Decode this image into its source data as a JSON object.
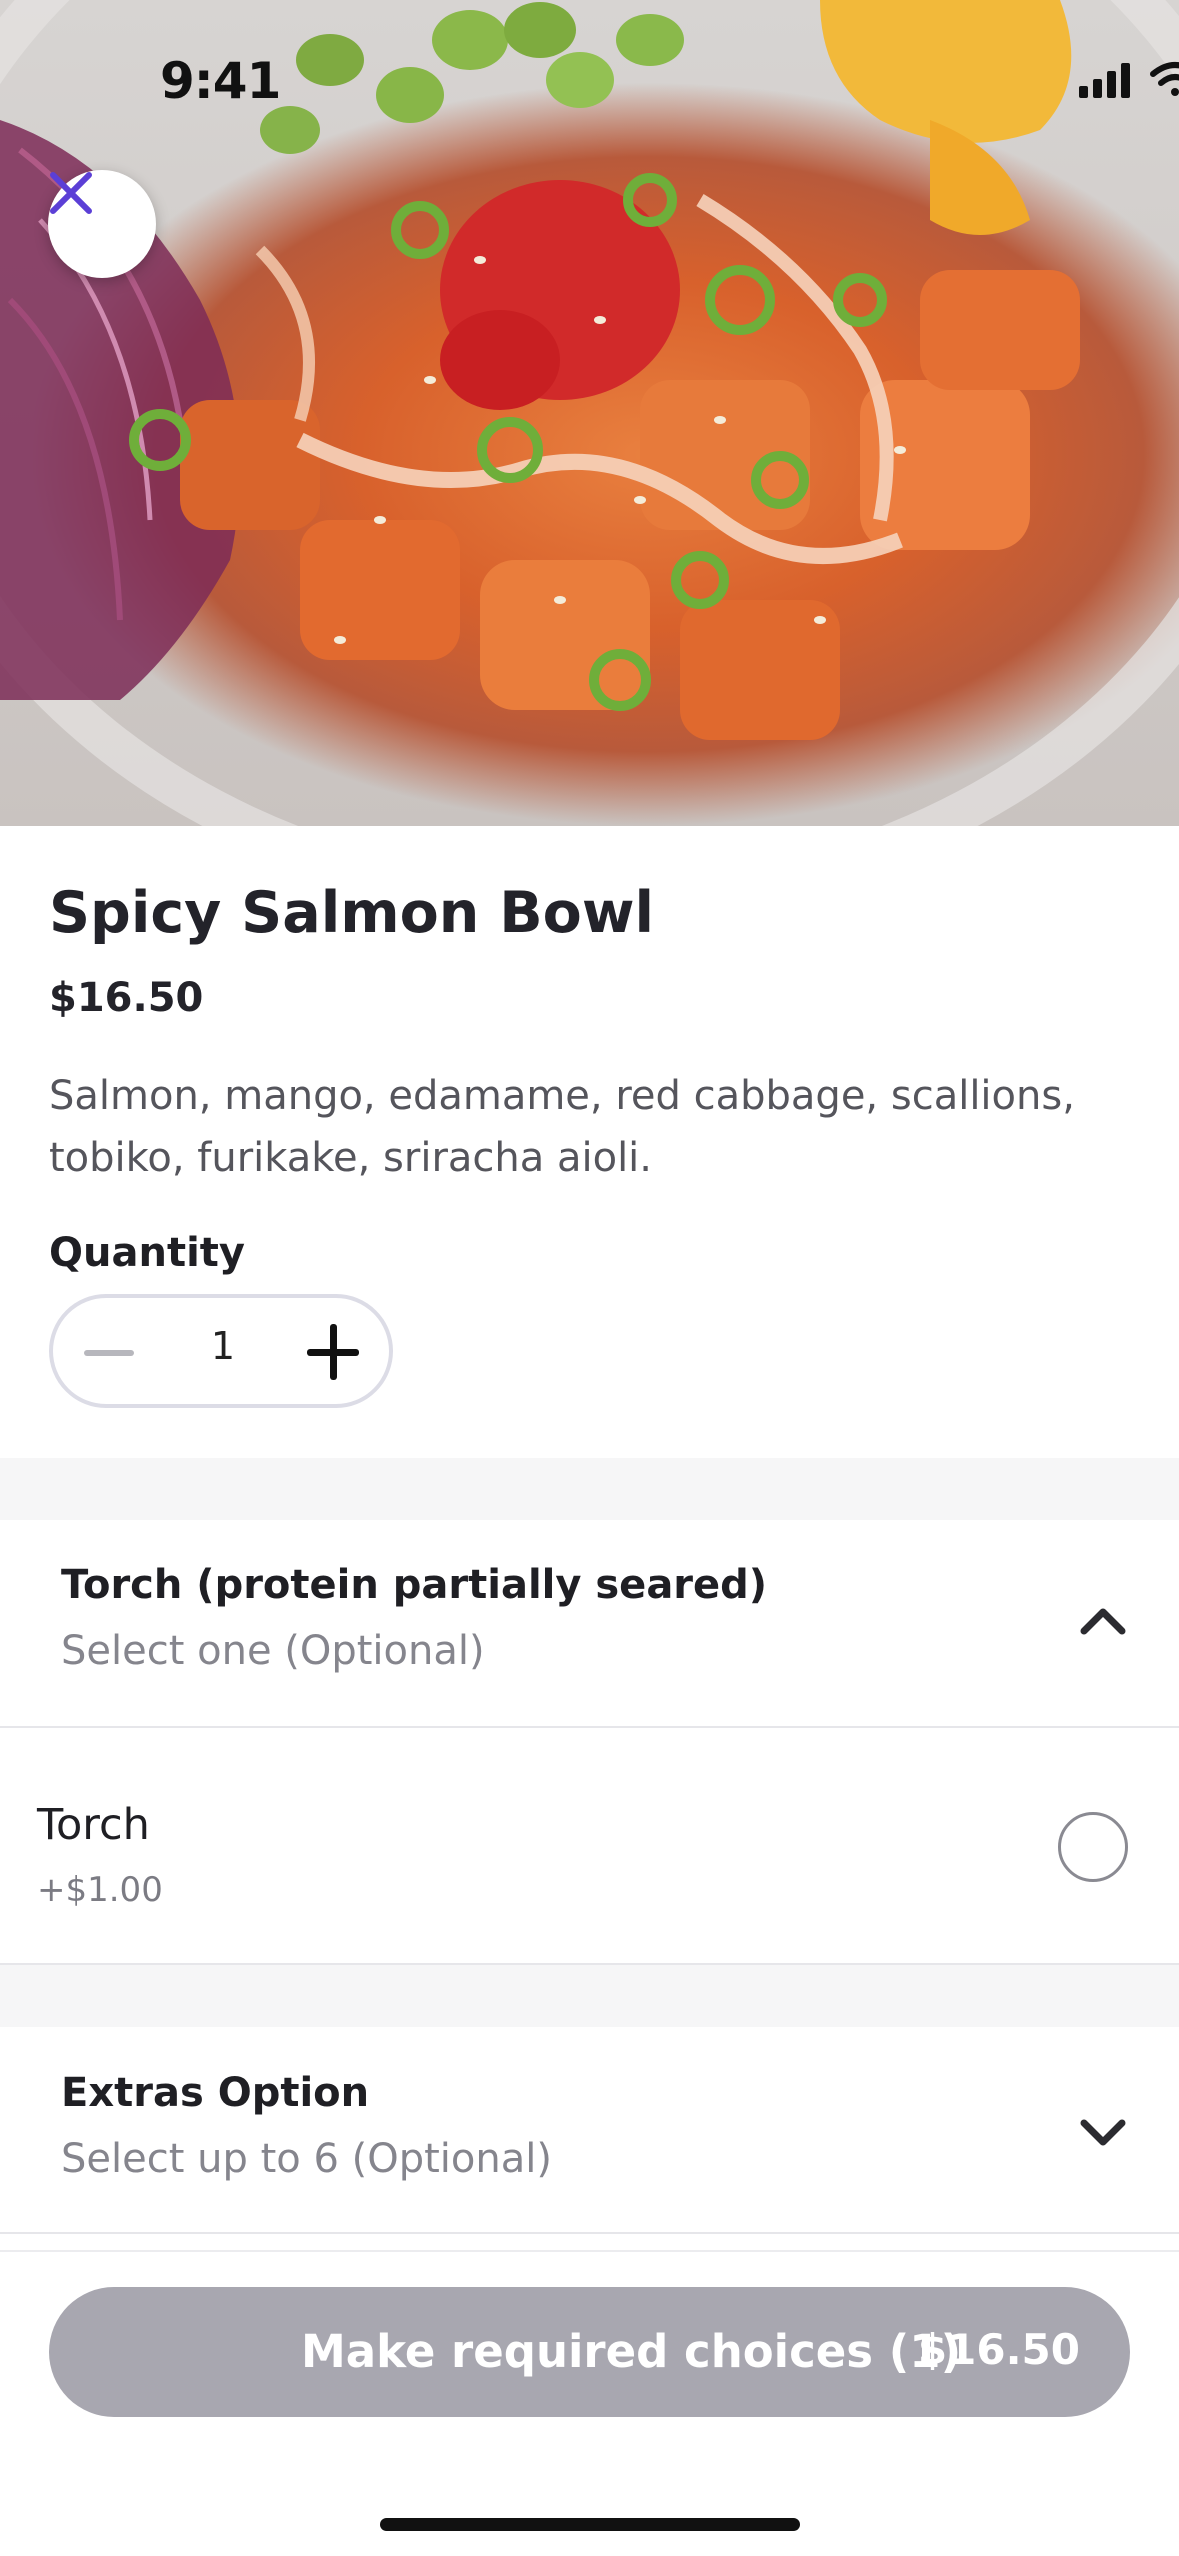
{
  "status_bar": {
    "time": "9:41"
  },
  "hero": {
    "image_icon": "poke-bowl-photo"
  },
  "product": {
    "title": "Spicy Salmon Bowl",
    "price": "$16.50",
    "description": "Salmon, mango, edamame, red cabbage, scallions, tobiko, furikake, sriracha aioli."
  },
  "quantity": {
    "label": "Quantity",
    "value": "1"
  },
  "sections": [
    {
      "title": "Torch (protein partially seared)",
      "subtitle": "Select one (Optional)",
      "expanded": true,
      "options": [
        {
          "name": "Torch",
          "price": "+$1.00",
          "selected": false
        }
      ]
    },
    {
      "title": "Extras Option",
      "subtitle": "Select up to 6 (Optional)",
      "expanded": false
    }
  ],
  "cta": {
    "label": "Make required choices (1)",
    "price": "$16.50"
  },
  "colors": {
    "accent": "#5b3fd6",
    "cta_disabled": "#a8a7b0"
  }
}
